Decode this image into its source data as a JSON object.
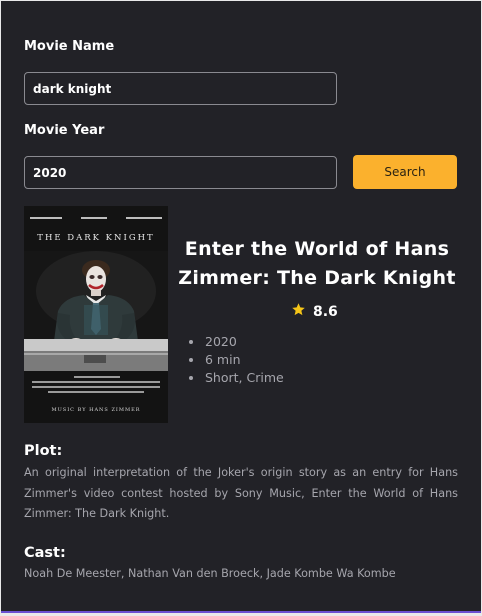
{
  "form": {
    "movie_name_label": "Movie Name",
    "movie_name_value": "dark knight",
    "movie_year_label": "Movie Year",
    "movie_year_value": "2020",
    "search_label": "Search"
  },
  "movie": {
    "poster_title": "THE DARK KNIGHT",
    "poster_music_credit": "MUSIC BY HANS ZIMMER",
    "title": "Enter the World of Hans Zimmer: The Dark Knight",
    "rating": "8.6",
    "details": [
      "2020",
      "6 min",
      "Short, Crime"
    ],
    "plot_heading": "Plot:",
    "plot": "An original interpretation of the Joker's origin story as an entry for Hans Zimmer's video contest hosted by Sony Music, Enter the World of Hans Zimmer: The Dark Knight.",
    "cast_heading": "Cast:",
    "cast": "Noah De Meester, Nathan Van den Broeck, Jade Kombe Wa Kombe"
  },
  "icons": {
    "rating": "star-icon"
  },
  "colors": {
    "background": "#222227",
    "accent": "#fbb12d",
    "star": "#f5c518",
    "muted_text": "#a6a6ad"
  }
}
